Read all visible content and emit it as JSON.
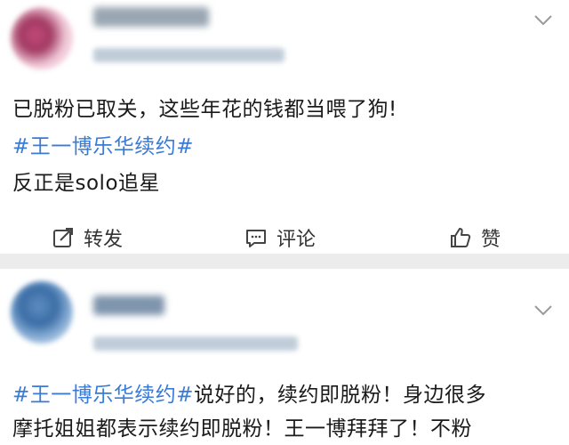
{
  "posts": [
    {
      "lines": [
        {
          "text": "已脱粉已取关，这些年花的钱都当喂了狗!"
        },
        {
          "topic": "#王一博乐华续约#"
        },
        {
          "text": "反正是solo追星"
        }
      ],
      "actions": {
        "repost_label": "转发",
        "comment_label": "评论",
        "like_label": "赞",
        "repost_icon": "repost-icon",
        "comment_icon": "comment-icon",
        "like_icon": "thumbs-up-icon"
      }
    },
    {
      "lines": [
        {
          "topic": "#王一博乐华续约#",
          "text": "说好的，续约即脱粉！身边很多"
        },
        {
          "text": "摩托姐姐都表示续约即脱粉！王一博拜拜了！不粉"
        }
      ]
    }
  ],
  "colors": {
    "topic": "#3a7bd5",
    "text": "#1a1a1a",
    "separator": "#ececec"
  }
}
